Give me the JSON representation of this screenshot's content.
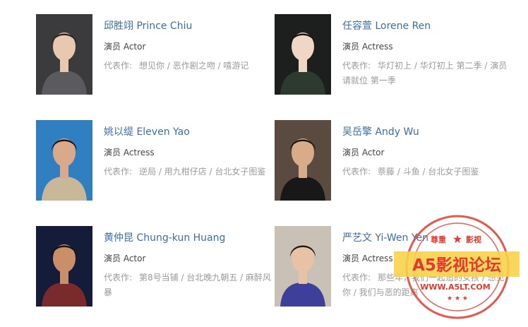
{
  "actors": [
    {
      "name": "邱胜翊 Prince Chiu",
      "role": "演员 Actor",
      "works_label": "代表作:",
      "works": "想见你 / 恶作剧之吻 / 嘻游记",
      "photo": "male-portrait-grey-jacket",
      "bg": "#3b3b3e",
      "skin": "#e8c9b0",
      "hair": "#2a2320",
      "cloth": "#5b5b5f"
    },
    {
      "name": "任容萱 Lorene Ren",
      "role": "演员 Actress",
      "works_label": "代表作:",
      "works": "华灯初上 / 华灯初上 第二季 / 演员请就位 第一季",
      "photo": "female-portrait-dark",
      "bg": "#1d1f1e",
      "skin": "#f0d6c4",
      "hair": "#141414",
      "cloth": "#2d3a30"
    },
    {
      "name": "姚以缇 Eleven Yao",
      "role": "演员 Actress",
      "works_label": "代表作:",
      "works": "逆局 / 用九柑仔店 / 台北女子图鉴",
      "photo": "female-portrait-blue",
      "bg": "#2f7fc1",
      "skin": "#d9a98a",
      "hair": "#1b1410",
      "cloth": "#c9b79a"
    },
    {
      "name": "吴岳擎 Andy Wu",
      "role": "演员 Actor",
      "works_label": "代表作:",
      "works": "萘藤 / 斗鱼 / 台北女子图鉴",
      "photo": "male-portrait-black-tee",
      "bg": "#5a4a40",
      "skin": "#d8ab8a",
      "hair": "#1a1512",
      "cloth": "#181818"
    },
    {
      "name": "黄仲昆 Chung-kun Huang",
      "role": "演员 Actor",
      "works_label": "代表作:",
      "works": "第8号当铺 / 台北晚九朝五 / 麻醉风暴",
      "photo": "male-portrait-striped",
      "bg": "#141c3a",
      "skin": "#c98f6a",
      "hair": "#111111",
      "cloth": "#7a2a2a"
    },
    {
      "name": "严艺文 Yi-Wen Yen",
      "role": "演员 Actress",
      "works_label": "代表作:",
      "works": "那些年，我们一起追的女孩 / 想见你 / 我们与恶的距离",
      "photo": "female-portrait-purple",
      "bg": "#c9c1b5",
      "skin": "#e7c2a6",
      "hair": "#1c1814",
      "cloth": "#3d3f9a"
    }
  ],
  "watermark": {
    "top": "尊重",
    "top2": "影视",
    "title": "A5影视论坛",
    "url": "WWW.A5LT.COM",
    "color": "#e23a2e",
    "band": "#f7d34a"
  }
}
